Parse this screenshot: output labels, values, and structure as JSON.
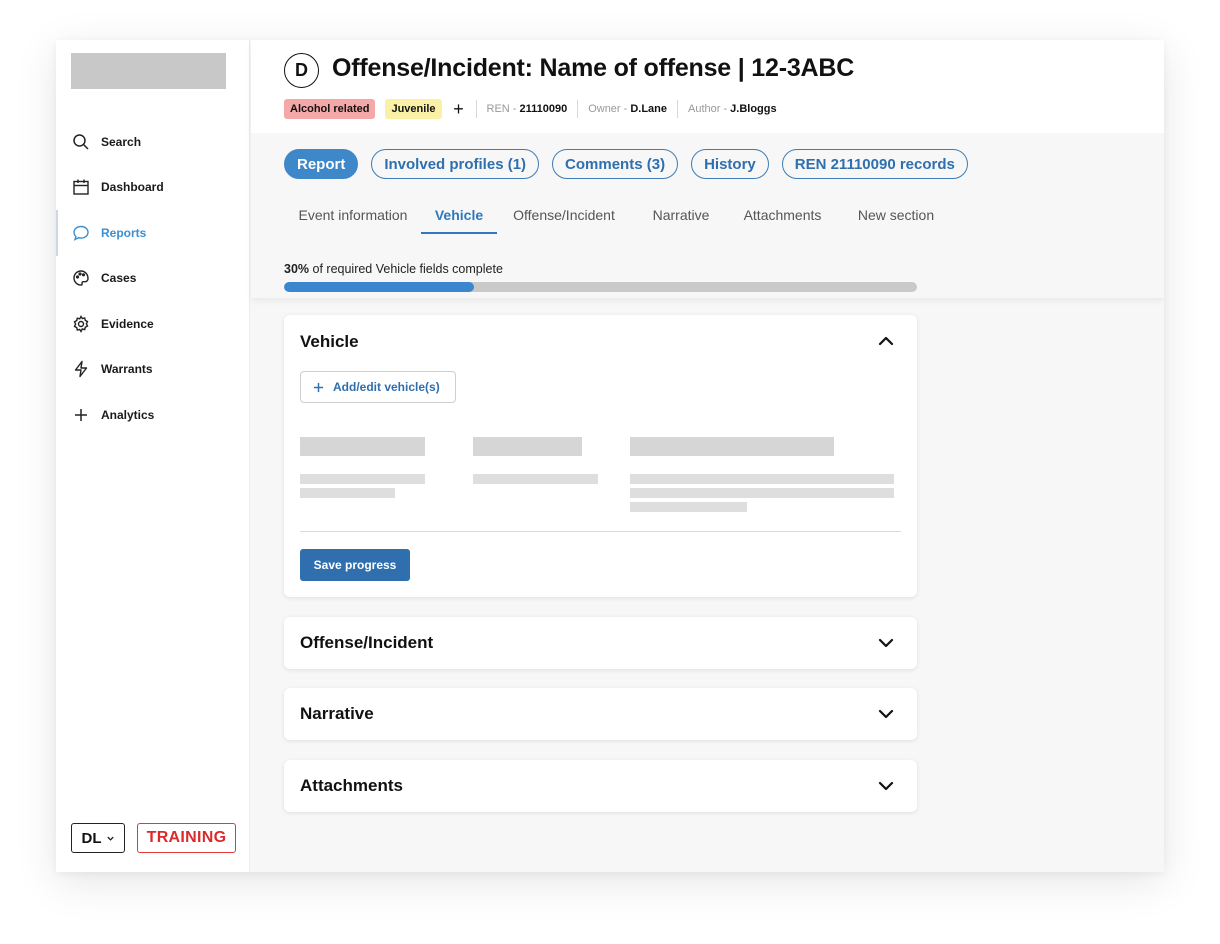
{
  "sidebar": {
    "items": [
      {
        "label": "Search",
        "icon": "search-icon"
      },
      {
        "label": "Dashboard",
        "icon": "calendar-icon"
      },
      {
        "label": "Reports",
        "icon": "chat-bubble-icon",
        "active": true
      },
      {
        "label": "Cases",
        "icon": "palette-icon"
      },
      {
        "label": "Evidence",
        "icon": "gear-icon"
      },
      {
        "label": "Warrants",
        "icon": "lightning-icon"
      },
      {
        "label": "Analytics",
        "icon": "plus-icon"
      }
    ],
    "user_initials": "DL",
    "environment_badge": "TRAINING"
  },
  "header": {
    "avatar_letter": "D",
    "title": "Offense/Incident: Name of offense | 12-3ABC",
    "tags": [
      "Alcohol related",
      "Juvenile"
    ],
    "add_tag_symbol": "+",
    "ren_label": "REN -",
    "ren_value": "21110090",
    "owner_label": "Owner -",
    "owner_value": "D.Lane",
    "author_label": "Author -",
    "author_value": "J.Bloggs"
  },
  "pills": [
    {
      "label": "Report",
      "active": true
    },
    {
      "label": "Involved profiles (1)"
    },
    {
      "label": "Comments (3)"
    },
    {
      "label": "History"
    },
    {
      "label": "REN 21110090 records"
    }
  ],
  "tabs": [
    {
      "label": "Event information"
    },
    {
      "label": "Vehicle",
      "active": true
    },
    {
      "label": "Offense/Incident"
    },
    {
      "label": "Narrative"
    },
    {
      "label": "Attachments"
    },
    {
      "label": "New section"
    }
  ],
  "progress": {
    "percent_text": "30%",
    "suffix": " of required Vehicle fields complete",
    "value": 0.3
  },
  "sections": {
    "vehicle": {
      "title": "Vehicle",
      "add_button": "Add/edit vehicle(s)",
      "save_button": "Save progress",
      "expanded": true
    },
    "offense": {
      "title": "Offense/Incident",
      "expanded": false
    },
    "narrative": {
      "title": "Narrative",
      "expanded": false
    },
    "attachments": {
      "title": "Attachments",
      "expanded": false
    }
  },
  "colors": {
    "accent": "#2f6fae",
    "active_nav": "#3c8fd0",
    "tag_red": "#f4a8a8",
    "tag_yellow": "#fbf1a6",
    "training_red": "#d92b2b"
  }
}
